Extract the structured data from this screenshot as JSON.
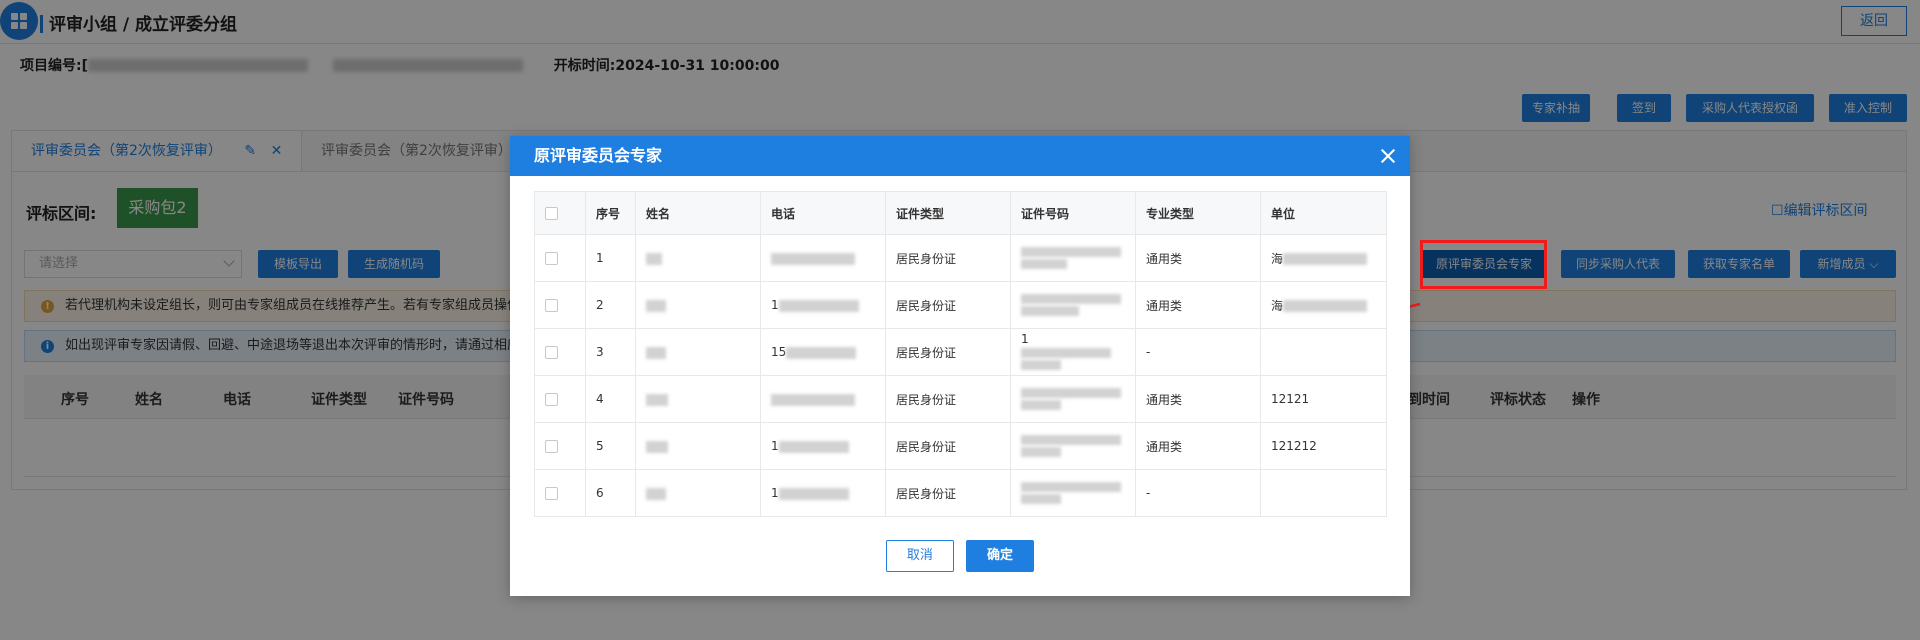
{
  "header": {
    "breadcrumb": "评审小组 / 成立评委分组",
    "back_label": "返回"
  },
  "project_info": {
    "project_no_label": "项目编号:",
    "project_no_prefix": "[",
    "bid_time_label": "开标时间:",
    "bid_time_value": "2024-10-31 10:00:00"
  },
  "top_actions": [
    "专家补抽",
    "签到",
    "采购人代表授权函",
    "准入控制"
  ],
  "tabs": [
    {
      "label": "评审委员会（第2次恢复评审）",
      "active": true
    },
    {
      "label": "评审委员会（第2次恢复评审）",
      "active": false
    }
  ],
  "zone": {
    "label": "评标区间:",
    "package": "采购包2",
    "edit_label": "编辑评标区间"
  },
  "toolbar": {
    "select_placeholder": "请选择",
    "template_export": "模板导出",
    "gen_code": "生成随机码",
    "orig_experts": "原评审委员会专家",
    "sync_rep": "同步采购人代表",
    "get_list": "获取专家名单",
    "add_member": "新增成员"
  },
  "notices": {
    "warn": "若代理机构未设定组长，则可由专家组成员在线推荐产生。若有专家组成员操作",
    "info": "如出现评审专家因请假、回避、中途退场等退出本次评审的情形时，请通过相应"
  },
  "bg_table_headers": [
    "序号",
    "姓名",
    "电话",
    "证件类型",
    "证件号码",
    "到时间",
    "评标状态",
    "操作"
  ],
  "dialog": {
    "title": "原评审委员会专家",
    "columns": [
      "序号",
      "姓名",
      "电话",
      "证件类型",
      "证件号码",
      "专业类型",
      "单位"
    ],
    "rows": [
      {
        "no": "1",
        "name": "",
        "phone": "",
        "id_type": "居民身份证",
        "id_no": "",
        "major": "通用类",
        "unit": "海"
      },
      {
        "no": "2",
        "name": "",
        "phone": "1",
        "id_type": "居民身份证",
        "id_no": "",
        "major": "通用类",
        "unit": "海"
      },
      {
        "no": "3",
        "name": "",
        "phone": "15",
        "id_type": "居民身份证",
        "id_no": "1",
        "major": "-",
        "unit": ""
      },
      {
        "no": "4",
        "name": "",
        "phone": "",
        "id_type": "居民身份证",
        "id_no": "",
        "major": "通用类",
        "unit": "12121"
      },
      {
        "no": "5",
        "name": "",
        "phone": "1",
        "id_type": "居民身份证",
        "id_no": "",
        "major": "通用类",
        "unit": "121212"
      },
      {
        "no": "6",
        "name": "",
        "phone": "1",
        "id_type": "居民身份证",
        "id_no": "",
        "major": "-",
        "unit": ""
      }
    ],
    "cancel_label": "取消",
    "ok_label": "确定"
  },
  "colors": {
    "primary": "#1f7fe0",
    "package_green": "#3c9a4c",
    "annotation_red": "#f11b1b"
  }
}
